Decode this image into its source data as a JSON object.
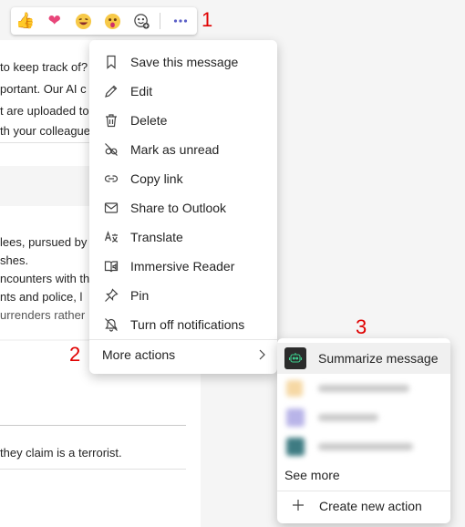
{
  "background": {
    "lines": [
      "to keep track of?",
      "portant. Our AI c",
      "t are uploaded to",
      "th your colleague",
      "lees, pursued by",
      "shes.",
      "ncounters with th",
      "nts and police, l",
      "urrenders rather"
    ],
    "bottom_text": "they claim is a terrorist."
  },
  "reaction_bar": {
    "items": [
      "like",
      "heart",
      "laugh",
      "surprised",
      "add-reaction",
      "more-options"
    ]
  },
  "annotations": [
    "1",
    "2",
    "3"
  ],
  "context_menu": {
    "items": [
      {
        "label": "Save this message",
        "icon": "bookmark-icon"
      },
      {
        "label": "Edit",
        "icon": "pencil-icon"
      },
      {
        "label": "Delete",
        "icon": "trash-icon"
      },
      {
        "label": "Mark as unread",
        "icon": "eye-off-icon"
      },
      {
        "label": "Copy link",
        "icon": "link-icon"
      },
      {
        "label": "Share to Outlook",
        "icon": "mail-icon"
      },
      {
        "label": "Translate",
        "icon": "translate-icon"
      },
      {
        "label": "Immersive Reader",
        "icon": "reader-icon"
      },
      {
        "label": "Pin",
        "icon": "pin-icon"
      },
      {
        "label": "Turn off notifications",
        "icon": "bell-off-icon"
      }
    ],
    "more_actions": "More actions"
  },
  "submenu": {
    "summarize": "Summarize message",
    "see_more": "See more",
    "create_new": "Create new action"
  },
  "colors": {
    "annotation": "#e00000",
    "reaction_more": "#5b5fc7"
  }
}
